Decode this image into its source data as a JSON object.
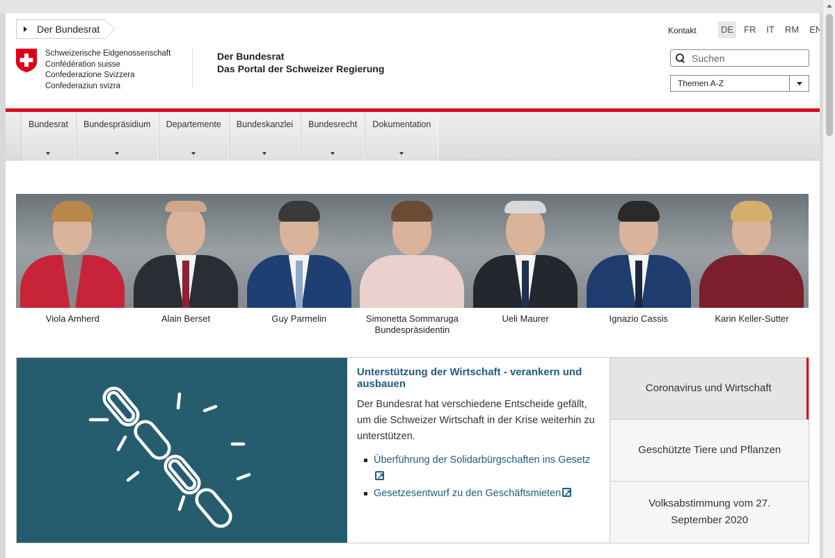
{
  "header": {
    "breadcrumb": "Der Bundesrat",
    "cantons": [
      "Schweizerische Eidgenossenschaft",
      "Confédération suisse",
      "Confederazione Svizzera",
      "Confederaziun svizra"
    ],
    "portal_title": "Der Bundesrat",
    "portal_subtitle": "Das Portal der Schweizer Regierung",
    "contact": "Kontakt",
    "languages": [
      "DE",
      "FR",
      "IT",
      "RM",
      "EN"
    ],
    "active_language": "DE",
    "search_placeholder": "Suchen",
    "topics_label": "Themen A-Z",
    "accent_color": "#dc0018"
  },
  "nav": {
    "items": [
      "Bundesrat",
      "Bundespräsidium",
      "Departemente",
      "Bundeskanzlei",
      "Bundesrecht",
      "Dokumentation"
    ]
  },
  "council": {
    "members": [
      {
        "name": "Viola Amherd",
        "role": ""
      },
      {
        "name": "Alain Berset",
        "role": ""
      },
      {
        "name": "Guy Parmelin",
        "role": ""
      },
      {
        "name": "Simonetta Sommaruga",
        "role": "Bundespräsidentin"
      },
      {
        "name": "Ueli Maurer",
        "role": ""
      },
      {
        "name": "Ignazio Cassis",
        "role": ""
      },
      {
        "name": "Karin Keller-Sutter",
        "role": ""
      }
    ]
  },
  "feature": {
    "image_icon": "broken-chain-icon",
    "title": "Unterstützung der Wirtschaft - verankern und ausbauen",
    "description": "Der Bundesrat hat verschiedene Entscheide gefällt, um die Schweizer Wirtschaft in der Krise weiterhin zu unterstützen.",
    "links": [
      "Überführung der Solidarbürgschaften ins Gesetz",
      "Gesetzesentwurf zu den Geschäftsmieten"
    ],
    "tabs": [
      "Coronavirus und Wirtschaft",
      "Geschützte Tiere und Pflanzen",
      "Volksabstimmung vom 27. September 2020"
    ],
    "active_tab": 0
  }
}
